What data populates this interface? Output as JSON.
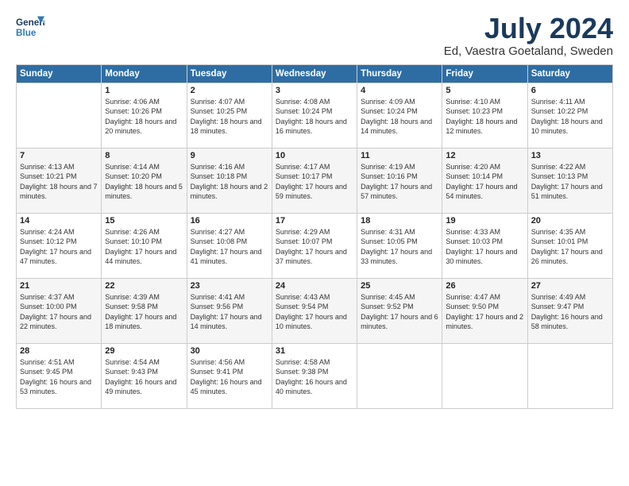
{
  "logo": {
    "line1": "General",
    "line2": "Blue"
  },
  "title": "July 2024",
  "subtitle": "Ed, Vaestra Goetaland, Sweden",
  "headers": [
    "Sunday",
    "Monday",
    "Tuesday",
    "Wednesday",
    "Thursday",
    "Friday",
    "Saturday"
  ],
  "weeks": [
    [
      {
        "day": "",
        "sunrise": "",
        "sunset": "",
        "daylight": ""
      },
      {
        "day": "1",
        "sunrise": "Sunrise: 4:06 AM",
        "sunset": "Sunset: 10:26 PM",
        "daylight": "Daylight: 18 hours and 20 minutes."
      },
      {
        "day": "2",
        "sunrise": "Sunrise: 4:07 AM",
        "sunset": "Sunset: 10:25 PM",
        "daylight": "Daylight: 18 hours and 18 minutes."
      },
      {
        "day": "3",
        "sunrise": "Sunrise: 4:08 AM",
        "sunset": "Sunset: 10:24 PM",
        "daylight": "Daylight: 18 hours and 16 minutes."
      },
      {
        "day": "4",
        "sunrise": "Sunrise: 4:09 AM",
        "sunset": "Sunset: 10:24 PM",
        "daylight": "Daylight: 18 hours and 14 minutes."
      },
      {
        "day": "5",
        "sunrise": "Sunrise: 4:10 AM",
        "sunset": "Sunset: 10:23 PM",
        "daylight": "Daylight: 18 hours and 12 minutes."
      },
      {
        "day": "6",
        "sunrise": "Sunrise: 4:11 AM",
        "sunset": "Sunset: 10:22 PM",
        "daylight": "Daylight: 18 hours and 10 minutes."
      }
    ],
    [
      {
        "day": "7",
        "sunrise": "Sunrise: 4:13 AM",
        "sunset": "Sunset: 10:21 PM",
        "daylight": "Daylight: 18 hours and 7 minutes."
      },
      {
        "day": "8",
        "sunrise": "Sunrise: 4:14 AM",
        "sunset": "Sunset: 10:20 PM",
        "daylight": "Daylight: 18 hours and 5 minutes."
      },
      {
        "day": "9",
        "sunrise": "Sunrise: 4:16 AM",
        "sunset": "Sunset: 10:18 PM",
        "daylight": "Daylight: 18 hours and 2 minutes."
      },
      {
        "day": "10",
        "sunrise": "Sunrise: 4:17 AM",
        "sunset": "Sunset: 10:17 PM",
        "daylight": "Daylight: 17 hours and 59 minutes."
      },
      {
        "day": "11",
        "sunrise": "Sunrise: 4:19 AM",
        "sunset": "Sunset: 10:16 PM",
        "daylight": "Daylight: 17 hours and 57 minutes."
      },
      {
        "day": "12",
        "sunrise": "Sunrise: 4:20 AM",
        "sunset": "Sunset: 10:14 PM",
        "daylight": "Daylight: 17 hours and 54 minutes."
      },
      {
        "day": "13",
        "sunrise": "Sunrise: 4:22 AM",
        "sunset": "Sunset: 10:13 PM",
        "daylight": "Daylight: 17 hours and 51 minutes."
      }
    ],
    [
      {
        "day": "14",
        "sunrise": "Sunrise: 4:24 AM",
        "sunset": "Sunset: 10:12 PM",
        "daylight": "Daylight: 17 hours and 47 minutes."
      },
      {
        "day": "15",
        "sunrise": "Sunrise: 4:26 AM",
        "sunset": "Sunset: 10:10 PM",
        "daylight": "Daylight: 17 hours and 44 minutes."
      },
      {
        "day": "16",
        "sunrise": "Sunrise: 4:27 AM",
        "sunset": "Sunset: 10:08 PM",
        "daylight": "Daylight: 17 hours and 41 minutes."
      },
      {
        "day": "17",
        "sunrise": "Sunrise: 4:29 AM",
        "sunset": "Sunset: 10:07 PM",
        "daylight": "Daylight: 17 hours and 37 minutes."
      },
      {
        "day": "18",
        "sunrise": "Sunrise: 4:31 AM",
        "sunset": "Sunset: 10:05 PM",
        "daylight": "Daylight: 17 hours and 33 minutes."
      },
      {
        "day": "19",
        "sunrise": "Sunrise: 4:33 AM",
        "sunset": "Sunset: 10:03 PM",
        "daylight": "Daylight: 17 hours and 30 minutes."
      },
      {
        "day": "20",
        "sunrise": "Sunrise: 4:35 AM",
        "sunset": "Sunset: 10:01 PM",
        "daylight": "Daylight: 17 hours and 26 minutes."
      }
    ],
    [
      {
        "day": "21",
        "sunrise": "Sunrise: 4:37 AM",
        "sunset": "Sunset: 10:00 PM",
        "daylight": "Daylight: 17 hours and 22 minutes."
      },
      {
        "day": "22",
        "sunrise": "Sunrise: 4:39 AM",
        "sunset": "Sunset: 9:58 PM",
        "daylight": "Daylight: 17 hours and 18 minutes."
      },
      {
        "day": "23",
        "sunrise": "Sunrise: 4:41 AM",
        "sunset": "Sunset: 9:56 PM",
        "daylight": "Daylight: 17 hours and 14 minutes."
      },
      {
        "day": "24",
        "sunrise": "Sunrise: 4:43 AM",
        "sunset": "Sunset: 9:54 PM",
        "daylight": "Daylight: 17 hours and 10 minutes."
      },
      {
        "day": "25",
        "sunrise": "Sunrise: 4:45 AM",
        "sunset": "Sunset: 9:52 PM",
        "daylight": "Daylight: 17 hours and 6 minutes."
      },
      {
        "day": "26",
        "sunrise": "Sunrise: 4:47 AM",
        "sunset": "Sunset: 9:50 PM",
        "daylight": "Daylight: 17 hours and 2 minutes."
      },
      {
        "day": "27",
        "sunrise": "Sunrise: 4:49 AM",
        "sunset": "Sunset: 9:47 PM",
        "daylight": "Daylight: 16 hours and 58 minutes."
      }
    ],
    [
      {
        "day": "28",
        "sunrise": "Sunrise: 4:51 AM",
        "sunset": "Sunset: 9:45 PM",
        "daylight": "Daylight: 16 hours and 53 minutes."
      },
      {
        "day": "29",
        "sunrise": "Sunrise: 4:54 AM",
        "sunset": "Sunset: 9:43 PM",
        "daylight": "Daylight: 16 hours and 49 minutes."
      },
      {
        "day": "30",
        "sunrise": "Sunrise: 4:56 AM",
        "sunset": "Sunset: 9:41 PM",
        "daylight": "Daylight: 16 hours and 45 minutes."
      },
      {
        "day": "31",
        "sunrise": "Sunrise: 4:58 AM",
        "sunset": "Sunset: 9:38 PM",
        "daylight": "Daylight: 16 hours and 40 minutes."
      },
      {
        "day": "",
        "sunrise": "",
        "sunset": "",
        "daylight": ""
      },
      {
        "day": "",
        "sunrise": "",
        "sunset": "",
        "daylight": ""
      },
      {
        "day": "",
        "sunrise": "",
        "sunset": "",
        "daylight": ""
      }
    ]
  ]
}
